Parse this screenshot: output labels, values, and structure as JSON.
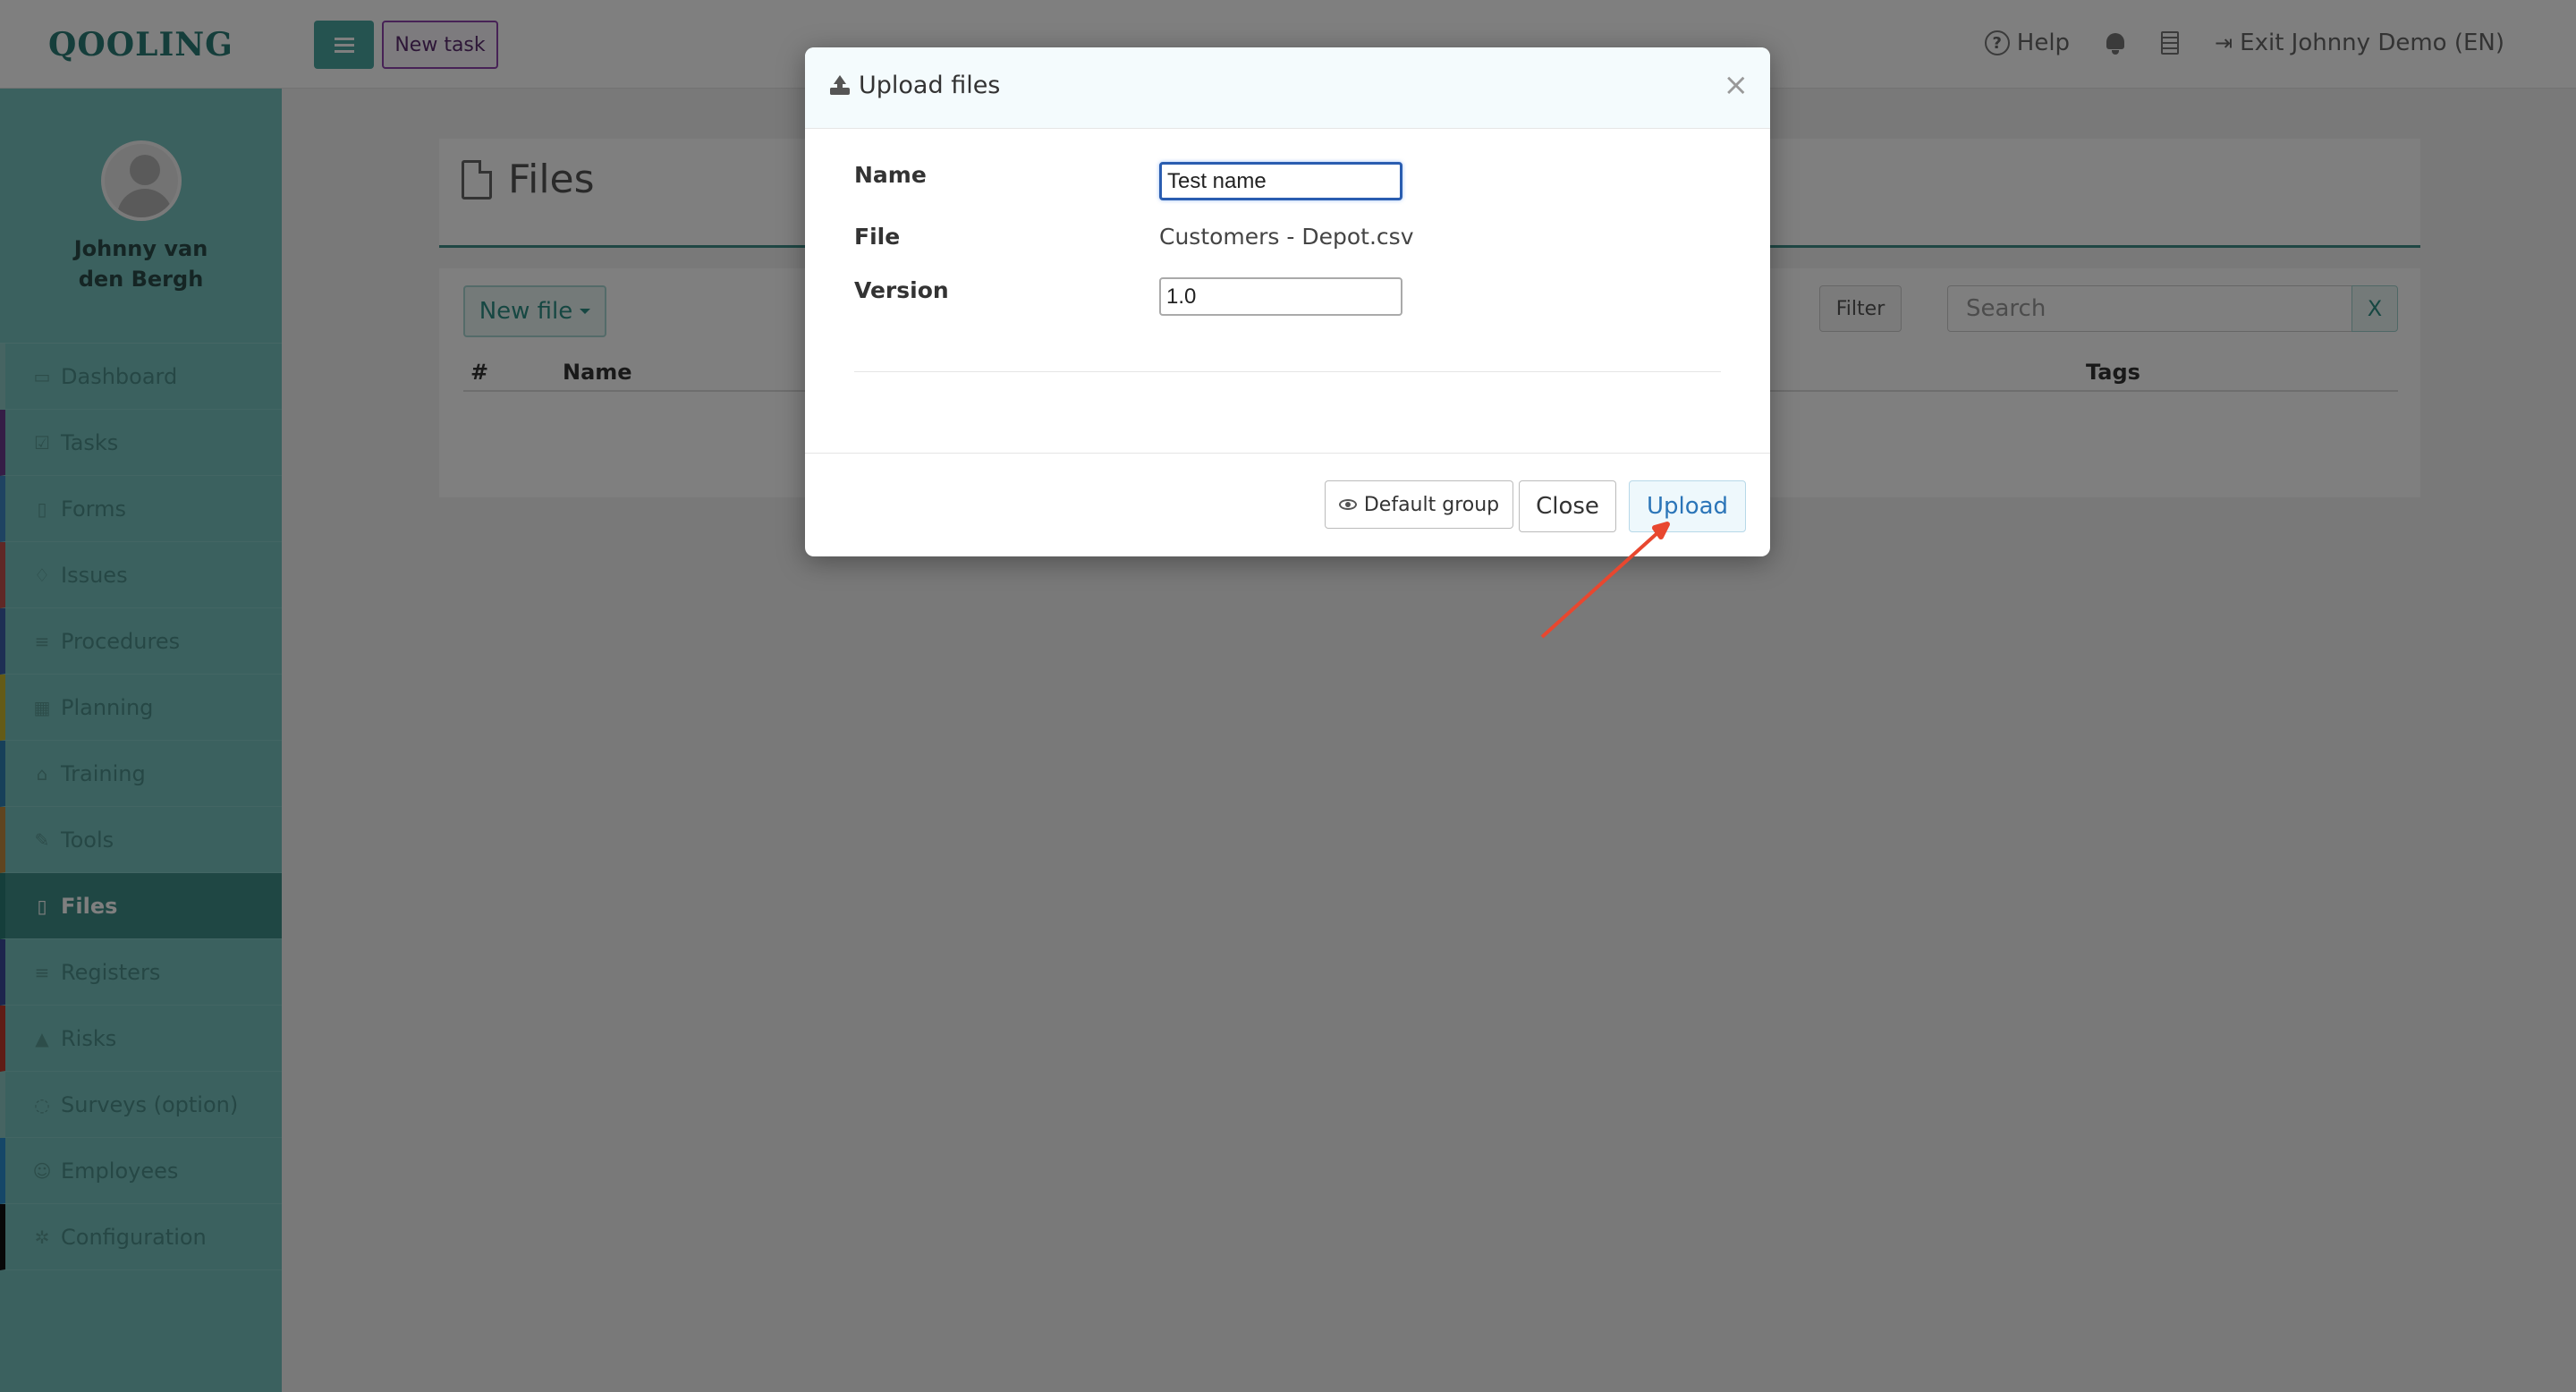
{
  "app": {
    "logo": "QOOLING"
  },
  "topbar": {
    "new_task_label": "New task",
    "help_label": "Help",
    "exit_label": "Exit Johnny Demo (EN)"
  },
  "profile": {
    "name": "Johnny van den Bergh"
  },
  "sidebar": {
    "items": [
      {
        "label": "Dashboard",
        "icon": "monitor-icon",
        "accent": "#8cc9c5"
      },
      {
        "label": "Tasks",
        "icon": "checkbox-icon",
        "accent": "#6a3a8c"
      },
      {
        "label": "Forms",
        "icon": "document-icon",
        "accent": "#3f86c4"
      },
      {
        "label": "Issues",
        "icon": "bell-icon",
        "accent": "#c0504d"
      },
      {
        "label": "Procedures",
        "icon": "list-icon",
        "accent": "#3d5ea8"
      },
      {
        "label": "Planning",
        "icon": "calendar-icon",
        "accent": "#c8b72e"
      },
      {
        "label": "Training",
        "icon": "graduation-cap-icon",
        "accent": "#2f80b5"
      },
      {
        "label": "Tools",
        "icon": "wrench-icon",
        "accent": "#c08a3e"
      },
      {
        "label": "Files",
        "icon": "file-icon",
        "accent": "#2a7d76",
        "active": true
      },
      {
        "label": "Registers",
        "icon": "list-icon",
        "accent": "#3b4a9b"
      },
      {
        "label": "Risks",
        "icon": "warning-icon",
        "accent": "#c0392b"
      },
      {
        "label": "Surveys (option)",
        "icon": "comment-icon",
        "accent": "#8cc9c5"
      },
      {
        "label": "Employees",
        "icon": "users-icon",
        "accent": "#2b8fd0"
      },
      {
        "label": "Configuration",
        "icon": "gear-icon",
        "accent": "#111111"
      }
    ]
  },
  "page": {
    "title": "Files",
    "new_file_label": "New file",
    "filter_label": "Filter",
    "search_placeholder": "Search",
    "search_clear_label": "X",
    "table_headers": {
      "index": "#",
      "name": "Name",
      "tags": "Tags"
    }
  },
  "modal": {
    "title": "Upload files",
    "close_symbol": "×",
    "fields": {
      "name_label": "Name",
      "name_value": "Test name",
      "file_label": "File",
      "file_value": "Customers - Depot.csv",
      "version_label": "Version",
      "version_value": "1.0"
    },
    "buttons": {
      "group_label": "Default group",
      "close_label": "Close",
      "upload_label": "Upload"
    }
  },
  "colors": {
    "brand": "#2a7d76",
    "sidebar_bg": "#76c2be",
    "active_item": "#3f8f89",
    "annotation_arrow": "#e8472f"
  }
}
